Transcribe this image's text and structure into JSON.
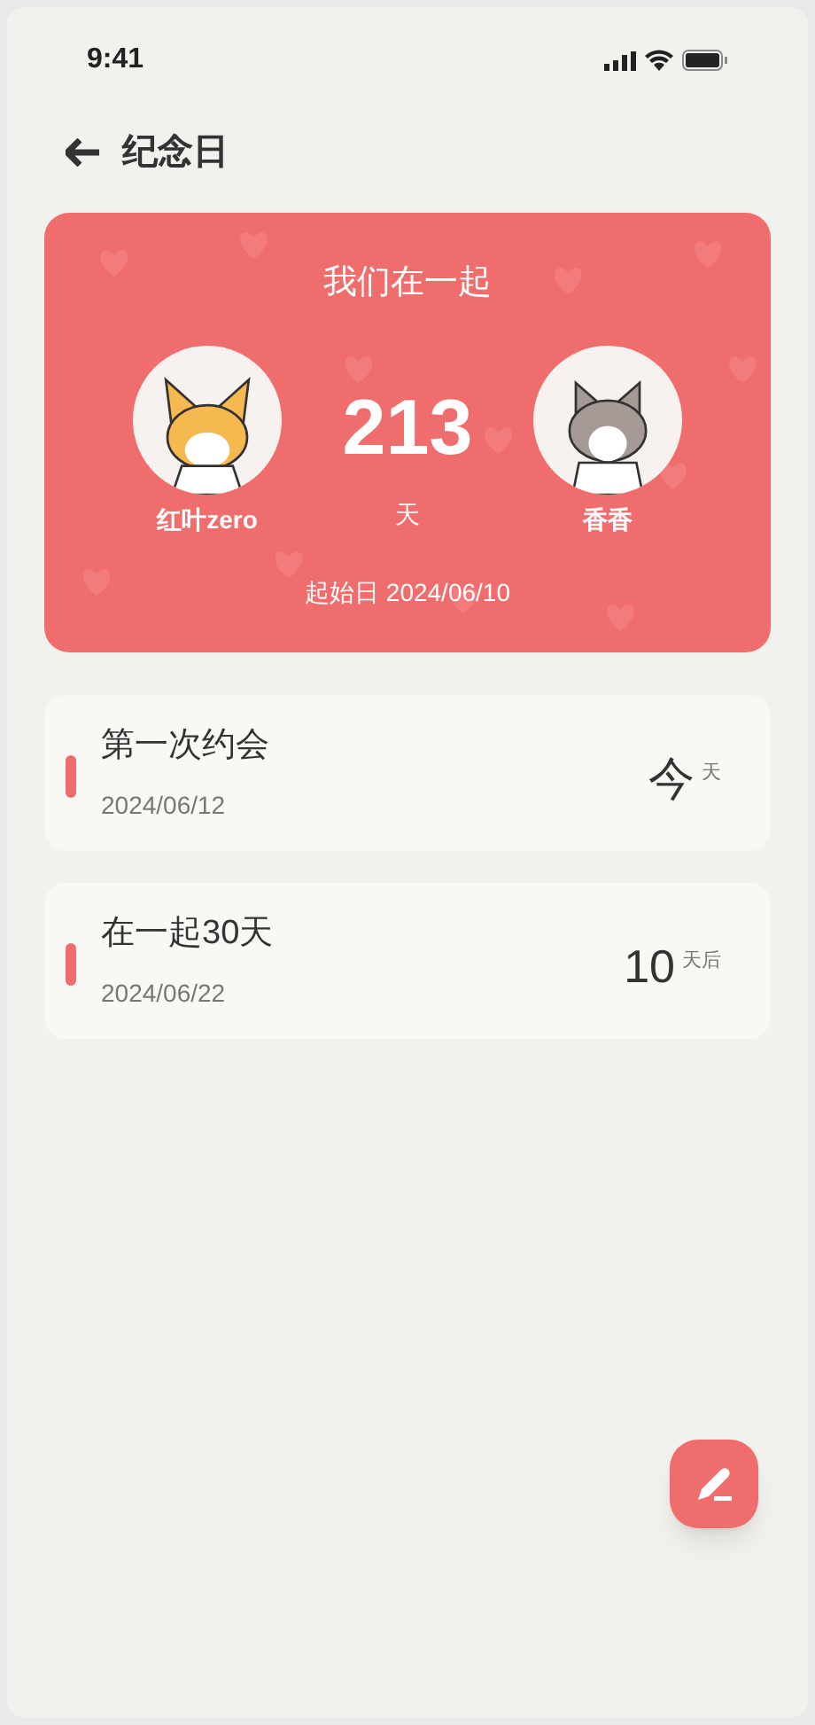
{
  "status_bar": {
    "time": "9:41"
  },
  "header": {
    "title": "纪念日"
  },
  "card": {
    "title": "我们在一起",
    "count": "213",
    "unit": "天",
    "start": "起始日 2024/06/10",
    "people": [
      {
        "name": "红叶zero",
        "kind": "dog"
      },
      {
        "name": "香香",
        "kind": "cat"
      }
    ]
  },
  "events": [
    {
      "title": "第一次约会",
      "date": "2024/06/12",
      "big": "今",
      "small": "天"
    },
    {
      "title": "在一起30天",
      "date": "2024/06/22",
      "big": "10",
      "small": "天后"
    }
  ]
}
